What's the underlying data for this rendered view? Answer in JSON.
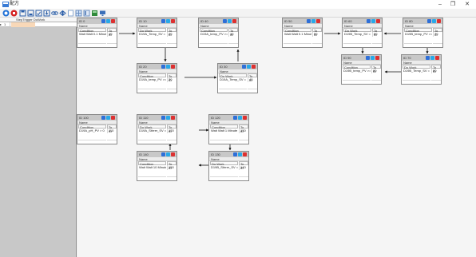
{
  "window": {
    "title": "配方",
    "minimize": "–",
    "maximize": "❐",
    "close": "✕"
  },
  "toolbar": {
    "icons": [
      "run-icon",
      "stop-icon",
      "save-icon",
      "save-as-icon",
      "open-icon",
      "import-icon",
      "link-icon",
      "unlink-icon",
      "blank-icon",
      "grid-icon",
      "layout-icon",
      "image-icon",
      "monitor-icon"
    ]
  },
  "sidebar": {
    "header": "StepTrigger  DoWork",
    "rows": [
      {
        "selector": "▸",
        "number": "1"
      }
    ]
  },
  "nodes": [
    {
      "key": "n0",
      "id": "ID   0",
      "name": "Name",
      "col_l": "Condition",
      "col_r": "To ID",
      "val_l": "Wait Walt 0.1 Minute",
      "val_r": "10"
    },
    {
      "key": "n10",
      "id": "ID   10",
      "name": "Name",
      "col_l": "Do Work",
      "col_r": "To ID",
      "val_l": "D19A_Temp_SV = 35.00",
      "val_r": "20"
    },
    {
      "key": "n40",
      "id": "ID   40",
      "name": "Name",
      "col_l": "Condition",
      "col_r": "To ID",
      "val_l": "D19A_temp_PV >= 33.80 °C",
      "val_r": "10"
    },
    {
      "key": "n50",
      "id": "ID   50",
      "name": "Name",
      "col_l": "Condition",
      "col_r": "To ID",
      "val_l": "Wait Walt 0.1 Minute",
      "val_r": "50"
    },
    {
      "key": "n60",
      "id": "ID   60",
      "name": "Name",
      "col_l": "Do Work",
      "col_r": "To ID",
      "val_l": "D19B_Temp_SV = 33.00",
      "val_r": "60"
    },
    {
      "key": "n80",
      "id": "ID   80",
      "name": "Name",
      "col_l": "Condition",
      "col_r": "To ID",
      "val_l": "D19B_temp_PV >= 33.10 °C",
      "val_r": "70"
    },
    {
      "key": "n20",
      "id": "ID   20",
      "name": "Name",
      "col_l": "Condition",
      "col_r": "To ID",
      "val_l": "D19A_temp_PV >= 33.10 °C",
      "val_r": "30"
    },
    {
      "key": "n30",
      "id": "ID   30",
      "name": "Name",
      "col_l": "Do Work",
      "col_r": "To ID",
      "val_l": "D19A_Temp_SV = 34.00",
      "val_r": "40"
    },
    {
      "key": "n90",
      "id": "ID   90",
      "name": "Name",
      "col_l": "Condition",
      "col_r": "To ID",
      "val_l": "D19B_temp_PV >= 33.80 °C",
      "val_r": "80"
    },
    {
      "key": "n70",
      "id": "ID   70",
      "name": "Name",
      "col_l": "Do Work",
      "col_r": "To ID",
      "val_l": "D19B_Temp_SV = 34.00",
      "val_r": "80"
    },
    {
      "key": "n100",
      "id": "ID   100",
      "name": "Name",
      "col_l": "Condition",
      "col_r": "To ID",
      "val_l": "D19A_pH_PV > 0",
      "val_r": "110"
    },
    {
      "key": "n110",
      "id": "ID   110",
      "name": "Name",
      "col_l": "Do Work",
      "col_r": "To ID",
      "val_l": "D19A_Stirrer_SV = 300",
      "val_r": "120"
    },
    {
      "key": "n120",
      "id": "ID   120",
      "name": "Name",
      "col_l": "Condition",
      "col_r": "To ID",
      "val_l": "Wait Walt 1 Minute",
      "val_r": "130"
    },
    {
      "key": "n140",
      "id": "ID   140",
      "name": "Name",
      "col_l": "Condition",
      "col_r": "To ID",
      "val_l": "Wait Walt 10 Minute",
      "val_r": "150"
    },
    {
      "key": "n130",
      "id": "ID   130",
      "name": "Name",
      "col_l": "Do Work",
      "col_r": "To ID",
      "val_l": "D19B_Stirrer_SV = 250",
      "val_r": "140"
    }
  ],
  "colors": {
    "edit_button": "#2e6fd8",
    "info_button": "#29a9e8",
    "delete_button": "#dd3030",
    "node_header": "#c8c8c8",
    "sidebar": "#c8c8c8"
  }
}
